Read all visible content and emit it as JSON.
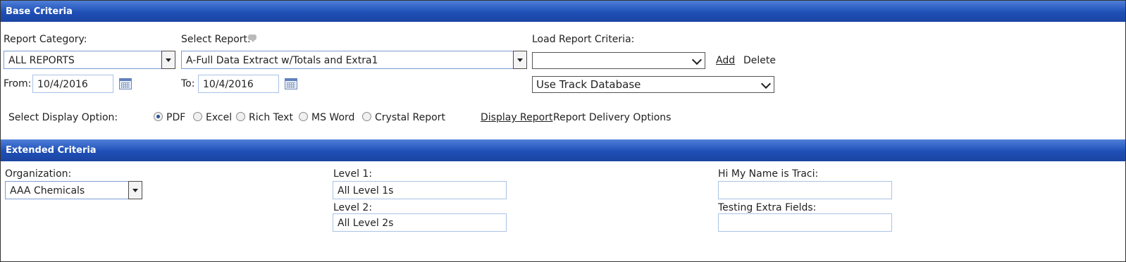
{
  "base": {
    "title": "Base Criteria",
    "report_category_label": "Report Category:",
    "report_category_value": "ALL REPORTS",
    "select_report_label": "Select Report:",
    "select_report_value": "A-Full Data Extract w/Totals and Extra1",
    "load_criteria_label": "Load Report Criteria:",
    "load_criteria_value": "",
    "add_label": "Add",
    "delete_label": "Delete",
    "from_label": "From:",
    "from_value": "10/4/2016",
    "to_label": "To:",
    "to_value": "10/4/2016",
    "database_value": "Use Track Database",
    "display_option_label": "Select Display Option:",
    "display_options": [
      "PDF",
      "Excel",
      "Rich Text",
      "MS Word",
      "Crystal Report"
    ],
    "selected_display_option": "PDF",
    "display_report_label": "Display Report",
    "delivery_options_label": "Report Delivery Options"
  },
  "extended": {
    "title": "Extended Criteria",
    "organization_label": "Organization:",
    "organization_value": "AAA Chemicals",
    "level1_label": "Level 1:",
    "level1_value": "All Level 1s",
    "level2_label": "Level 2:",
    "level2_value": "All Level 2s",
    "name_label": "Hi My Name is Traci:",
    "name_value": "",
    "testing_label": "Testing Extra Fields:",
    "testing_value": ""
  }
}
